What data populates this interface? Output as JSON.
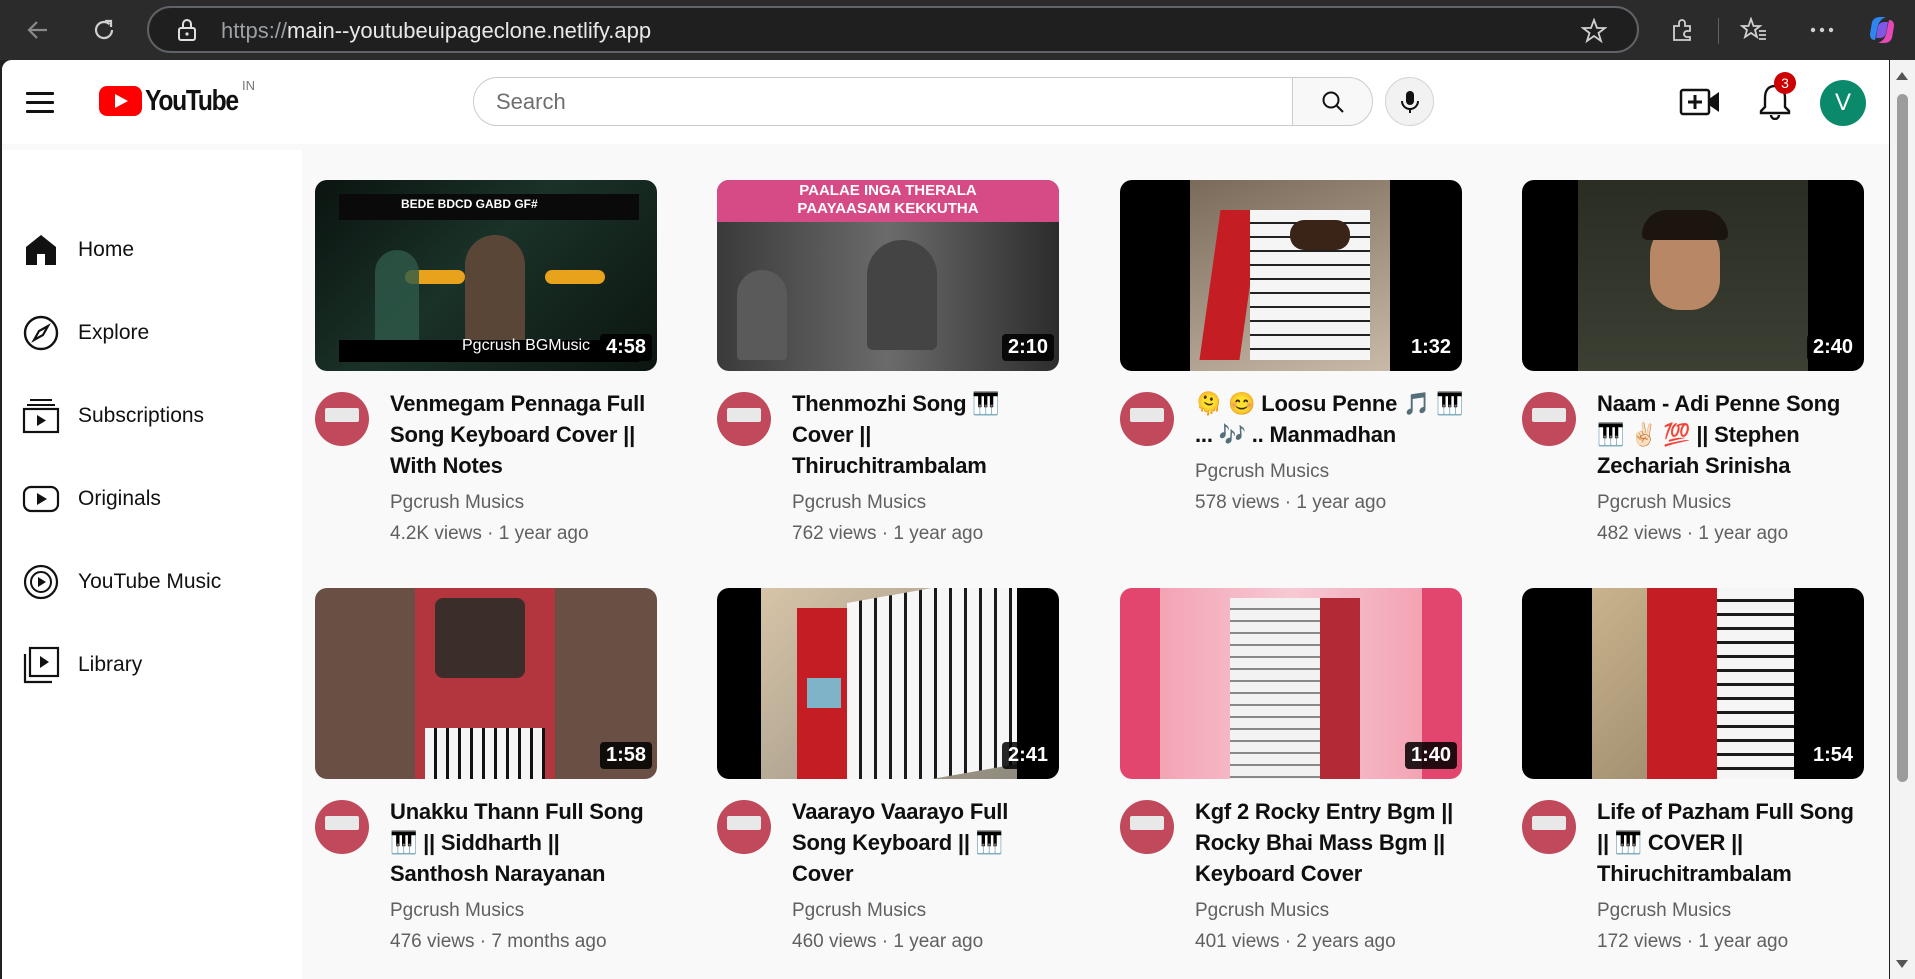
{
  "browser": {
    "url_scheme": "https://",
    "url_host": "main--youtubeuipageclone.netlify.app",
    "back_icon": "arrow-left-icon",
    "reload_icon": "reload-icon"
  },
  "header": {
    "logo_text": "YouTube",
    "region": "IN",
    "search_placeholder": "Search",
    "notification_count": "3",
    "avatar_letter": "V"
  },
  "sidebar": {
    "items": [
      {
        "label": "Home",
        "icon": "home-icon"
      },
      {
        "label": "Explore",
        "icon": "compass-icon"
      },
      {
        "label": "Subscriptions",
        "icon": "subscriptions-icon"
      },
      {
        "label": "Originals",
        "icon": "originals-icon"
      },
      {
        "label": "YouTube Music",
        "icon": "music-icon"
      },
      {
        "label": "Library",
        "icon": "library-icon"
      }
    ]
  },
  "videos": [
    {
      "title": "Venmegam Pennaga Full Song Keyboard Cover || With Notes",
      "channel": "Pgcrush Musics",
      "meta": "4.2K views · 1 year ago",
      "duration": "4:58",
      "thumb_caption_top": "BEDE BDCD GABD GF#",
      "thumb_caption_bottom": "Pgcrush BGMusic"
    },
    {
      "title": "Thenmozhi Song 🎹 Cover || Thiruchitrambalam",
      "channel": "Pgcrush Musics",
      "meta": "762 views · 1 year ago",
      "duration": "2:10",
      "thumb_caption_top": "PAALAE INGA THERALA\nPAAYAASAM KEKKUTHA"
    },
    {
      "title": "🫠 😊 Loosu Penne 🎵 🎹 ... 🎶 .. Manmadhan",
      "channel": "Pgcrush Musics",
      "meta": "578 views · 1 year ago",
      "duration": "1:32"
    },
    {
      "title": "Naam - Adi Penne Song 🎹 ✌🏻 💯 || Stephen Zechariah Srinisha",
      "channel": "Pgcrush Musics",
      "meta": "482 views · 1 year ago",
      "duration": "2:40"
    },
    {
      "title": "Unakku Thann Full Song 🎹 || Siddharth || Santhosh Narayanan",
      "channel": "Pgcrush Musics",
      "meta": "476 views · 7 months ago",
      "duration": "1:58"
    },
    {
      "title": "Vaarayo Vaarayo Full Song Keyboard || 🎹 Cover",
      "channel": "Pgcrush Musics",
      "meta": "460 views · 1 year ago",
      "duration": "2:41"
    },
    {
      "title": "Kgf 2 Rocky Entry Bgm || Rocky Bhai Mass Bgm || Keyboard Cover",
      "channel": "Pgcrush Musics",
      "meta": "401 views · 2 years ago",
      "duration": "1:40"
    },
    {
      "title": "Life of Pazham Full Song || 🎹 COVER || Thiruchitrambalam",
      "channel": "Pgcrush Musics",
      "meta": "172 views · 1 year ago",
      "duration": "1:54"
    }
  ]
}
